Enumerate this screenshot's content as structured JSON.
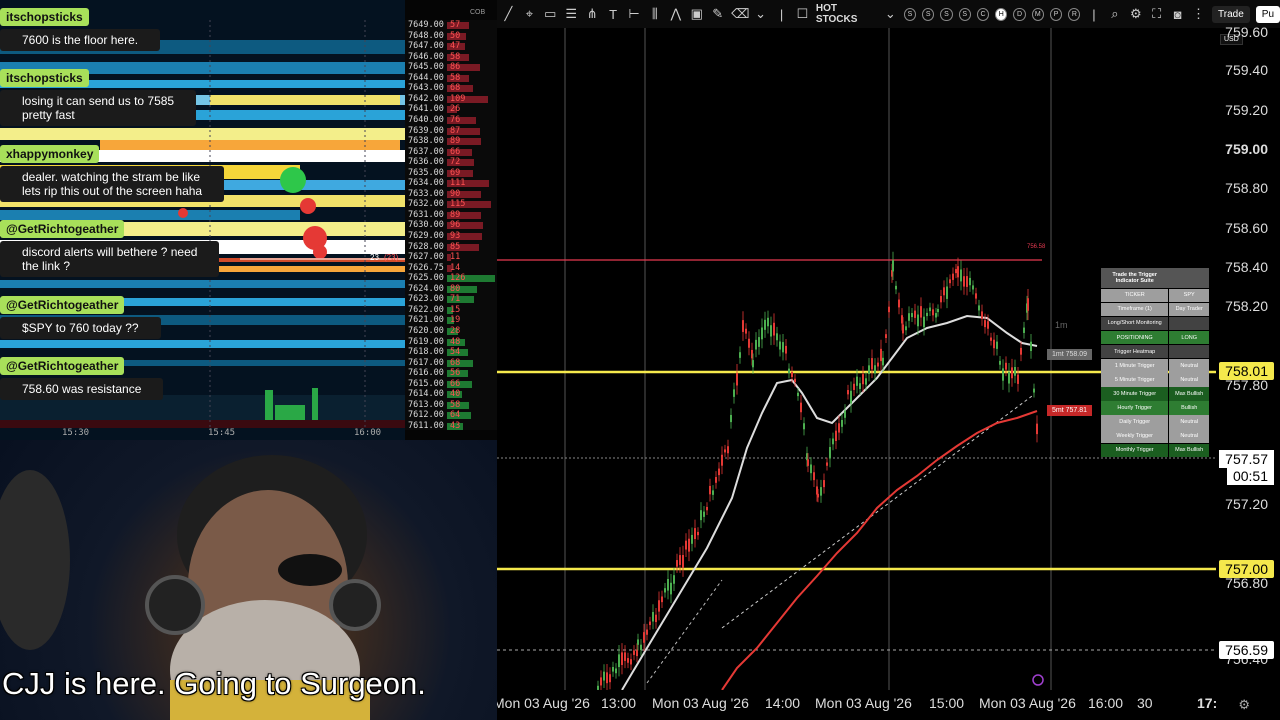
{
  "chat": [
    {
      "user": "itschopsticks",
      "lines": [
        "7600 is the floor here."
      ]
    },
    {
      "user": "itschopsticks",
      "lines": [
        "losing it can send us to 7585",
        "pretty fast"
      ]
    },
    {
      "user": "xhappymonkey",
      "lines": [
        "dealer. watching the stram be like",
        "lets rip this out of the screen haha"
      ]
    },
    {
      "user": "@GetRichtogeather",
      "lines": [
        "discord alerts will bethere ? need",
        "the link ?"
      ]
    },
    {
      "user": "@GetRichtogeather",
      "lines": [
        "$SPY to 760 today ??"
      ]
    },
    {
      "user": "@GetRichtogeather",
      "lines": [
        "758.60 was resistance"
      ]
    }
  ],
  "ladder": {
    "header": "COB",
    "rows": [
      {
        "price": "7649.00",
        "vol": "57"
      },
      {
        "price": "7648.00",
        "vol": "50"
      },
      {
        "price": "7647.00",
        "vol": "47"
      },
      {
        "price": "7646.00",
        "vol": "58"
      },
      {
        "price": "7645.00",
        "vol": "86"
      },
      {
        "price": "7644.00",
        "vol": "58"
      },
      {
        "price": "7643.00",
        "vol": "68"
      },
      {
        "price": "7642.00",
        "vol": "109"
      },
      {
        "price": "7641.00",
        "vol": "26"
      },
      {
        "price": "7640.00",
        "vol": "76"
      },
      {
        "price": "7639.00",
        "vol": "87"
      },
      {
        "price": "7638.00",
        "vol": "89"
      },
      {
        "price": "7637.00",
        "vol": "66"
      },
      {
        "price": "7636.00",
        "vol": "72"
      },
      {
        "price": "7635.00",
        "vol": "69"
      },
      {
        "price": "7634.00",
        "vol": "111"
      },
      {
        "price": "7633.00",
        "vol": "90"
      },
      {
        "price": "7632.00",
        "vol": "115"
      },
      {
        "price": "7631.00",
        "vol": "89"
      },
      {
        "price": "7630.00",
        "vol": "96"
      },
      {
        "price": "7629.00",
        "vol": "93"
      },
      {
        "price": "7628.00",
        "vol": "85"
      },
      {
        "price": "7627.00",
        "vol": "11"
      },
      {
        "price": "7626.75",
        "vol": "14"
      },
      {
        "price": "7625.00",
        "vol": "126"
      },
      {
        "price": "7624.00",
        "vol": "80"
      },
      {
        "price": "7623.00",
        "vol": "71"
      },
      {
        "price": "7622.00",
        "vol": "15"
      },
      {
        "price": "7621.00",
        "vol": "19"
      },
      {
        "price": "7620.00",
        "vol": "28"
      },
      {
        "price": "7619.00",
        "vol": "48"
      },
      {
        "price": "7618.00",
        "vol": "54"
      },
      {
        "price": "7617.00",
        "vol": "68"
      },
      {
        "price": "7616.00",
        "vol": "56"
      },
      {
        "price": "7615.00",
        "vol": "66"
      },
      {
        "price": "7614.00",
        "vol": "40"
      },
      {
        "price": "7613.00",
        "vol": "58"
      },
      {
        "price": "7612.00",
        "vol": "64"
      },
      {
        "price": "7611.00",
        "vol": "43"
      }
    ],
    "last_trade": "23",
    "last_trade_size": "(23)",
    "time_labels": [
      "15:30",
      "15:45",
      "16:00"
    ]
  },
  "subtitle": "CJJ is here. Going to Surgeon.",
  "toolbar": {
    "watchlist": "HOT STOCKS",
    "trade_button": "Trade",
    "publish_button": "Pu",
    "circle_buttons": [
      "S",
      "S",
      "S",
      "S",
      "C",
      "H",
      "D",
      "M",
      "P",
      "R"
    ]
  },
  "price_axis": {
    "currency": "USD",
    "labels": [
      "759.60",
      "759.40",
      "759.20",
      "759.00",
      "758.80",
      "758.60",
      "758.40",
      "758.20",
      "757.80",
      "757.40",
      "757.20",
      "756.80",
      "756.40"
    ],
    "tags": [
      {
        "text": "758.01",
        "kind": "yellow"
      },
      {
        "text": "757.57",
        "kind": "current"
      },
      {
        "text": "00:51",
        "kind": "current"
      },
      {
        "text": "757.00",
        "kind": "yellow"
      },
      {
        "text": "756.59",
        "kind": "white"
      }
    ]
  },
  "time_axis": {
    "labels": [
      "Mon 03 Aug '26",
      "13:00",
      "Mon 03 Aug '26",
      "14:00",
      "Mon 03 Aug '26",
      "15:00",
      "Mon 03 Aug '26",
      "16:00",
      "30",
      "17:"
    ]
  },
  "chart_annotations": {
    "top_line": "756.58",
    "interval": "1m",
    "ema_1min": "1mt 758.09",
    "ema_5min": "5mt 757.81"
  },
  "indicator_table": {
    "title": "Trade the Trigger Indicator Suite",
    "rows": [
      {
        "label": "TICKER",
        "value": "SPY",
        "color": "#9e9e9e"
      },
      {
        "label": "Timeframe (1)",
        "value": "Day Trader",
        "color": "#9e9e9e"
      },
      {
        "label": "Long/Short Monitoring",
        "value": "",
        "color": "#424242"
      },
      {
        "label": "POSITIONING",
        "value": "LONG",
        "color": "#2e7d32"
      },
      {
        "label": "Trigger Heatmap",
        "value": "",
        "color": "#424242"
      },
      {
        "label": "1 Minute Trigger",
        "value": "Neutral",
        "color": "#9e9e9e"
      },
      {
        "label": "5 Minute Trigger",
        "value": "Neutral",
        "color": "#9e9e9e"
      },
      {
        "label": "30 Minute Trigger",
        "value": "Max Bullish",
        "color": "#1b5e20"
      },
      {
        "label": "Hourly Trigger",
        "value": "Bullish",
        "color": "#2e7d32"
      },
      {
        "label": "Daily Trigger",
        "value": "Neutral",
        "color": "#9e9e9e"
      },
      {
        "label": "Weekly Trigger",
        "value": "Neutral",
        "color": "#9e9e9e"
      },
      {
        "label": "Monthly Trigger",
        "value": "Max Bullish",
        "color": "#1b5e20"
      }
    ]
  },
  "colors": {
    "chat_name_bg": "#a8e05a",
    "yellow_line": "#f5e94c",
    "red_line": "#e53935",
    "candle_up": "#4caf50",
    "candle_down": "#e53935"
  }
}
